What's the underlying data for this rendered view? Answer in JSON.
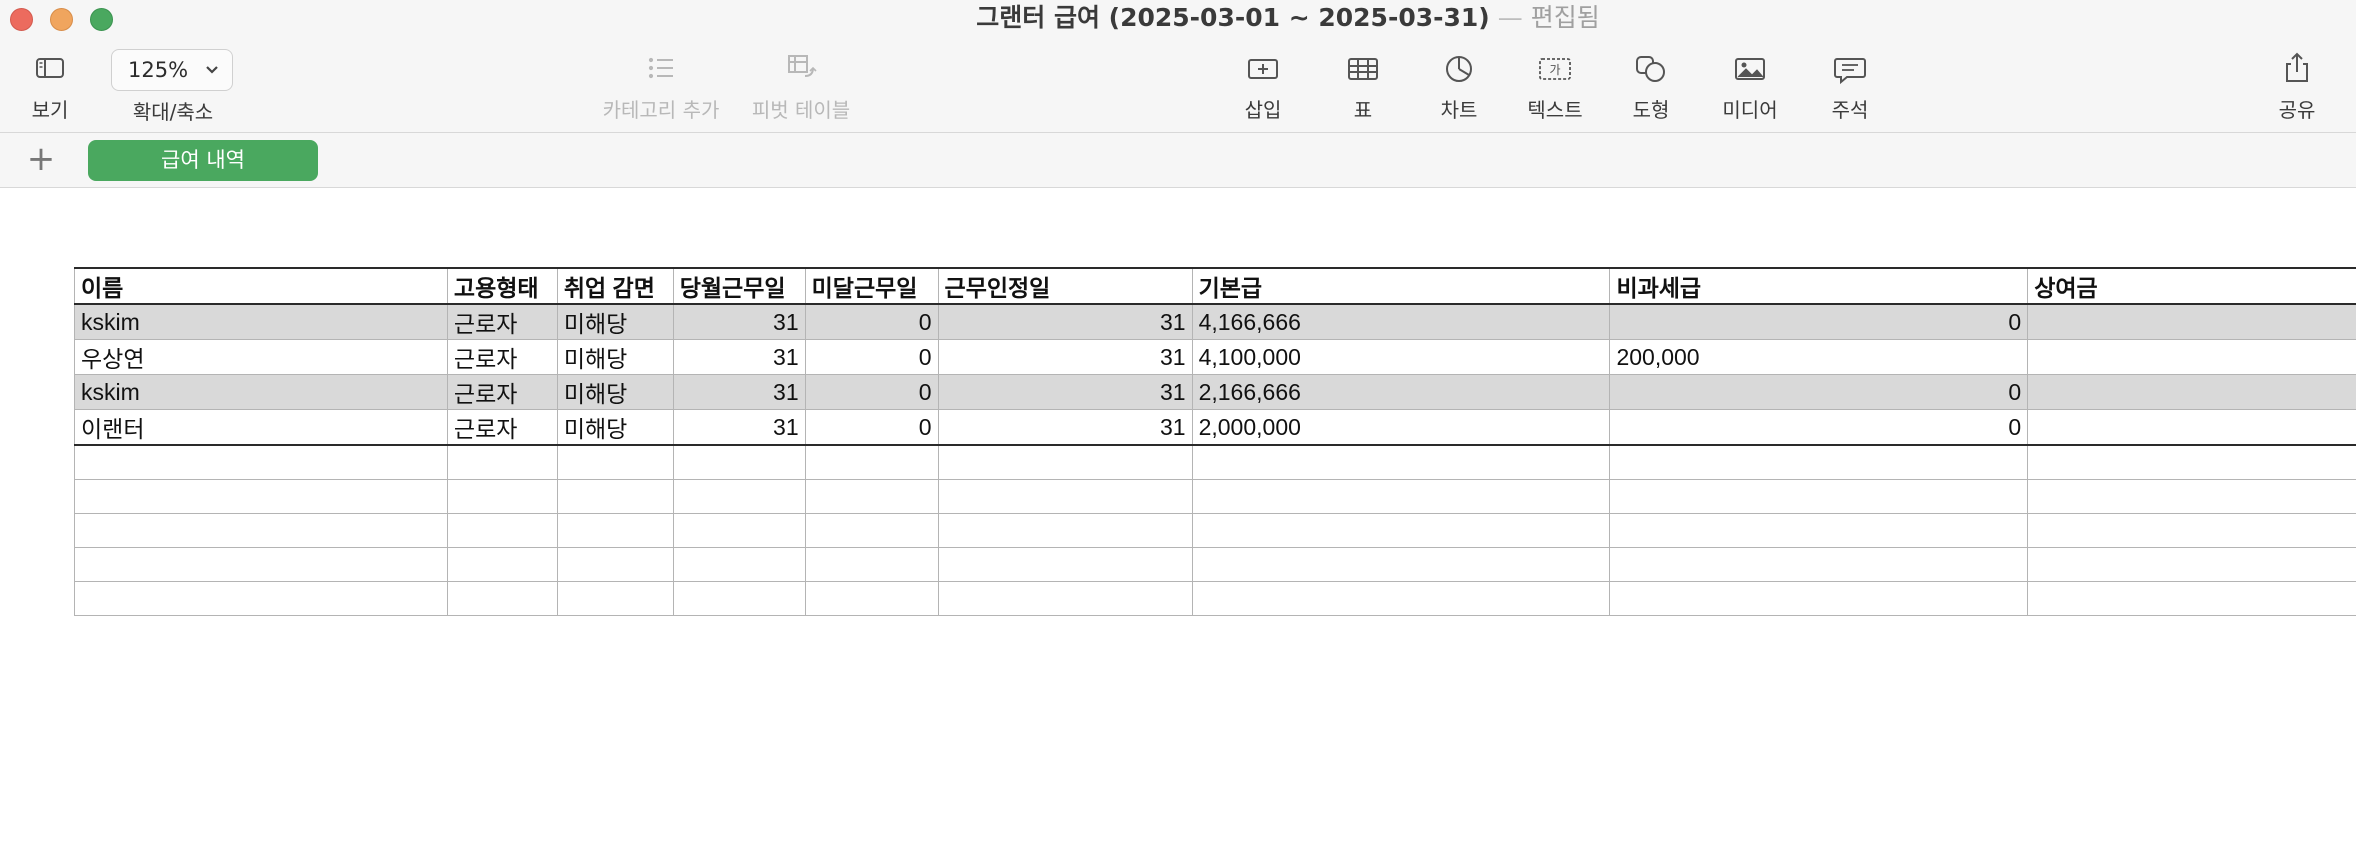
{
  "window": {
    "title": "그랜터 급여 (2025-03-01 ~ 2025-03-31)",
    "separator": "—",
    "state": "편집됨"
  },
  "toolbar": {
    "view_label": "보기",
    "zoom_value": "125%",
    "zoom_label": "확대/축소",
    "add_category_label": "카테고리 추가",
    "pivot_label": "피벗 테이블",
    "insert_label": "삽입",
    "table_label": "표",
    "chart_label": "차트",
    "text_label": "텍스트",
    "shape_label": "도형",
    "media_label": "미디어",
    "comment_label": "주석",
    "share_label": "공유",
    "text_icon_glyph": "가"
  },
  "sheets": {
    "add_symbol": "+",
    "tabs": [
      {
        "label": "급여 내역",
        "active": true
      }
    ]
  },
  "table": {
    "headers": [
      "이름",
      "고용형태",
      "취업 감면",
      "당월근무일",
      "미달근무일",
      "근무인정일",
      "기본급",
      "비과세급",
      "상여금"
    ],
    "rows": [
      [
        "kskim",
        "근로자",
        "미해당",
        "31",
        "0",
        "31",
        "4,166,666",
        "0",
        ""
      ],
      [
        "우상연",
        "근로자",
        "미해당",
        "31",
        "0",
        "31",
        "4,100,000",
        "200,000",
        ""
      ],
      [
        "kskim",
        "근로자",
        "미해당",
        "31",
        "0",
        "31",
        "2,166,666",
        "0",
        ""
      ],
      [
        "이랜터",
        "근로자",
        "미해당",
        "31",
        "0",
        "31",
        "2,000,000",
        "0",
        ""
      ]
    ],
    "empty_rows": 5
  },
  "colors": {
    "accent_green": "#4aa85f",
    "row_shade": "#d9d9d9",
    "toolbar_bg": "#f6f6f6"
  }
}
